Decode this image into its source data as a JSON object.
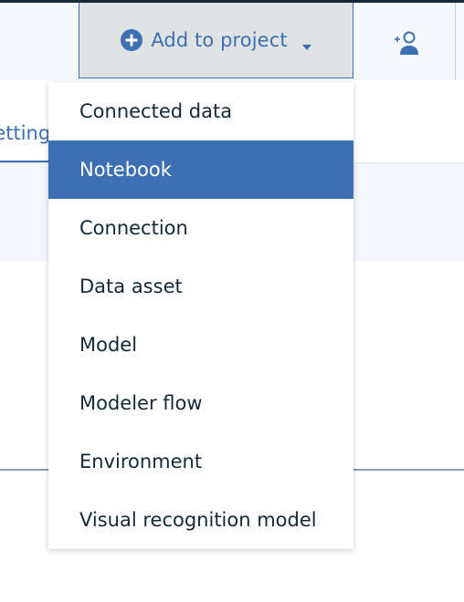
{
  "header": {
    "add_button_label": "Add to project"
  },
  "tabs": {
    "settings_label": "Settings"
  },
  "menu": {
    "items": [
      {
        "label": "Connected data"
      },
      {
        "label": "Notebook"
      },
      {
        "label": "Connection"
      },
      {
        "label": "Data asset"
      },
      {
        "label": "Model"
      },
      {
        "label": "Modeler flow"
      },
      {
        "label": "Environment"
      },
      {
        "label": "Visual recognition model"
      }
    ],
    "selected_index": 1
  },
  "colors": {
    "accent": "#3d70b2",
    "menu_text": "#152935",
    "header_bg": "#f4f7fb",
    "button_bg": "#dfe3e6"
  },
  "icons": {
    "add": "plus-circle-icon",
    "dropdown": "caret-down-icon",
    "collaborator": "add-collaborator-icon"
  }
}
